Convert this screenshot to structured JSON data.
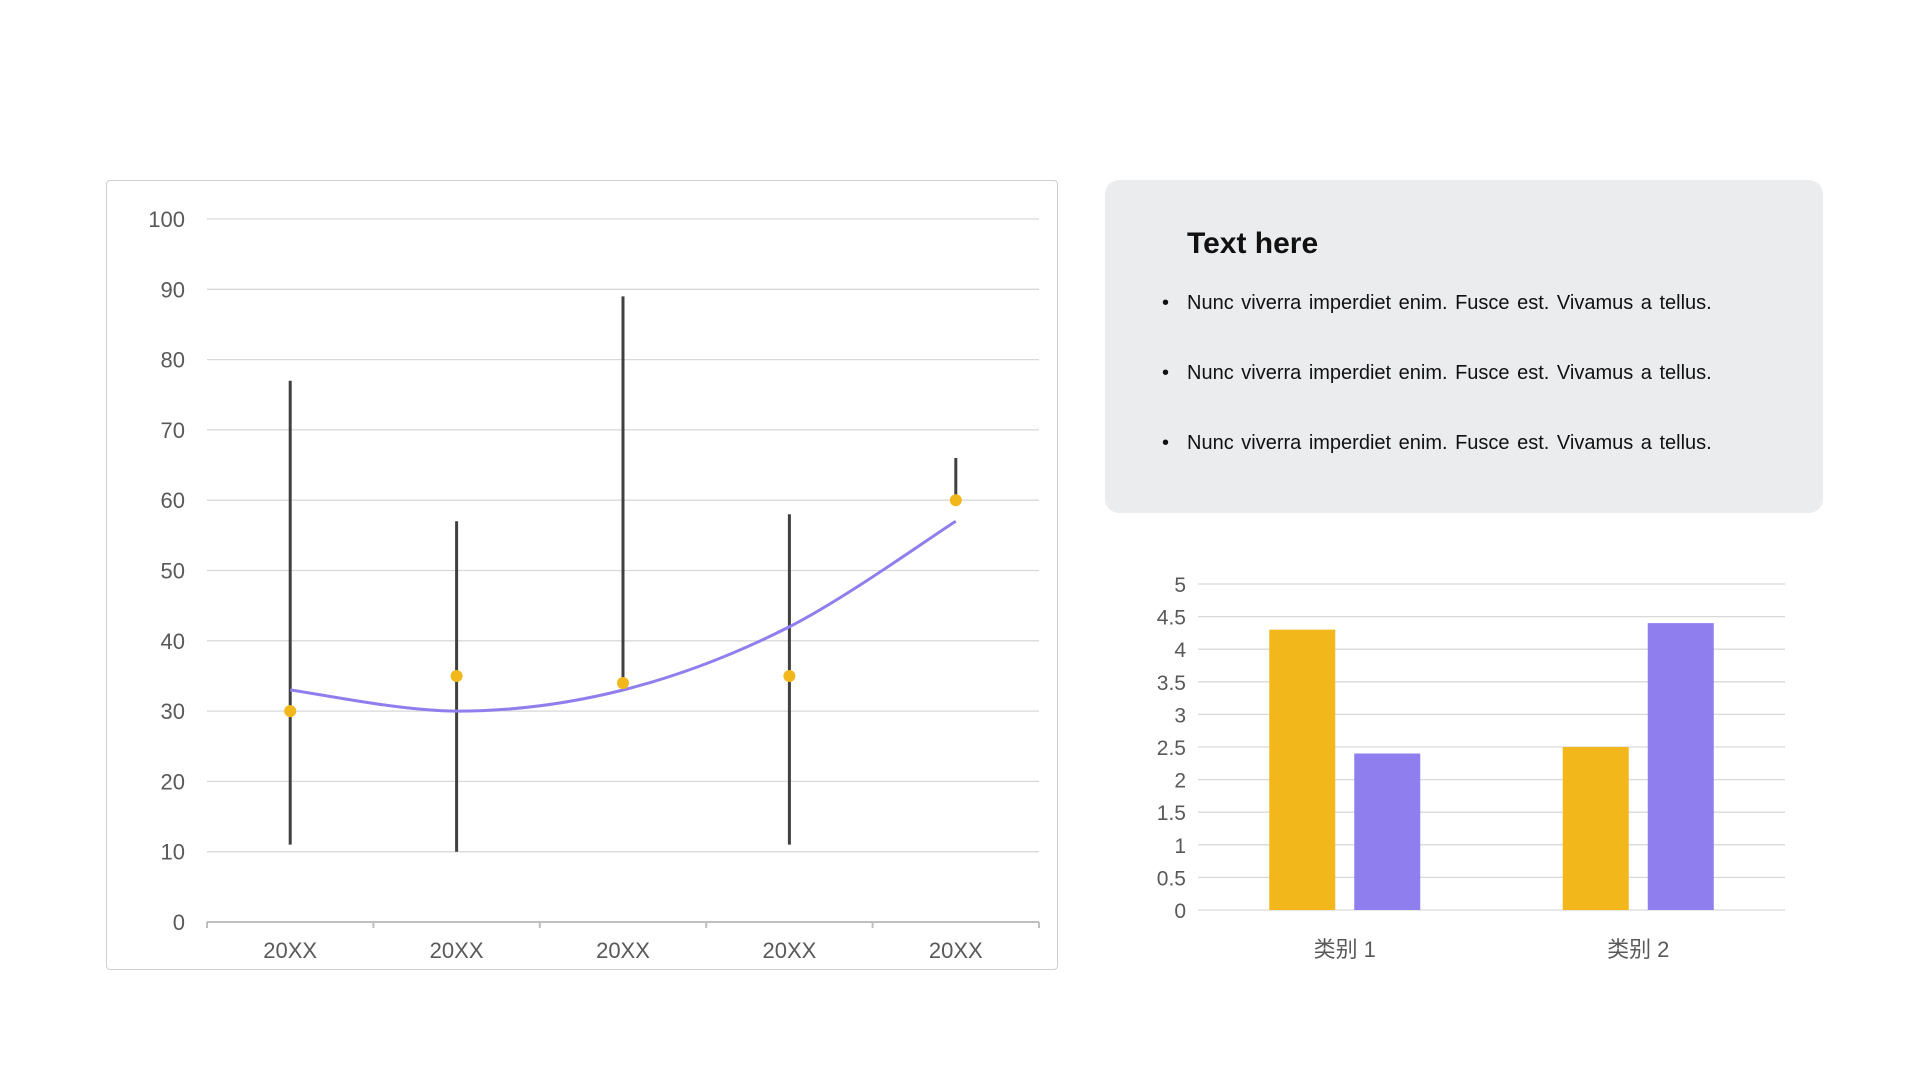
{
  "chart_data": [
    {
      "type": "line",
      "title": "",
      "xlabel": "",
      "ylabel": "",
      "categories": [
        "20XX",
        "20XX",
        "20XX",
        "20XX",
        "20XX"
      ],
      "yticks": [
        "0",
        "10",
        "20",
        "30",
        "40",
        "50",
        "60",
        "70",
        "80",
        "90",
        "100"
      ],
      "ylim": [
        0,
        100
      ],
      "grid": true,
      "series": [
        {
          "values": [
            30,
            35,
            34,
            35,
            60
          ],
          "color": "#f2b81b",
          "marker": "circle"
        }
      ],
      "ranges": [
        {
          "low": 11,
          "high": 77
        },
        {
          "low": 10,
          "high": 57
        },
        {
          "low": 34,
          "high": 89
        },
        {
          "low": 11,
          "high": 58
        },
        {
          "low": 60,
          "high": 66
        }
      ],
      "range_color": "#404040",
      "trendline": {
        "type": "polynomial",
        "values": [
          33,
          30,
          33,
          42,
          57
        ],
        "color": "#8f7fee"
      }
    },
    {
      "type": "bar",
      "title": "",
      "xlabel": "",
      "ylabel": "",
      "categories": [
        "类别 1",
        "类别 2"
      ],
      "yticks": [
        "0",
        "0.5",
        "1",
        "1.5",
        "2",
        "2.5",
        "3",
        "3.5",
        "4",
        "4.5",
        "5"
      ],
      "ylim": [
        0,
        5
      ],
      "grid": true,
      "series": [
        {
          "values": [
            4.3,
            2.5
          ],
          "color": "#f2b81b"
        },
        {
          "values": [
            2.4,
            4.4
          ],
          "color": "#8f7fee"
        }
      ]
    }
  ],
  "text_panel": {
    "title": "Text here",
    "bullet_symbol": "•",
    "bullets": [
      "Nunc viverra imperdiet enim. Fusce est. Vivamus a tellus.",
      "Nunc viverra imperdiet enim. Fusce est. Vivamus a tellus.",
      "Nunc viverra imperdiet enim. Fusce est. Vivamus a tellus."
    ]
  }
}
